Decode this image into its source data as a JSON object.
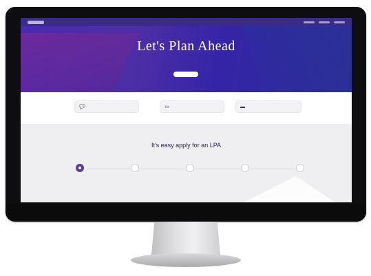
{
  "hero": {
    "title": "Let's Plan Ahead",
    "subtitle_line1": "",
    "subtitle_line2": "",
    "cta": ""
  },
  "cards": [
    {
      "icon": "chat-icon",
      "label": ""
    },
    {
      "icon": "document-icon",
      "label": ""
    },
    {
      "icon": "card-icon",
      "label": ""
    }
  ],
  "steps": {
    "title": "It's easy apply for an LPA",
    "items": [
      {
        "label": "",
        "active": true
      },
      {
        "label": "",
        "active": false
      },
      {
        "label": "",
        "active": false
      },
      {
        "label": "",
        "active": false
      },
      {
        "label": "",
        "active": false
      }
    ]
  }
}
